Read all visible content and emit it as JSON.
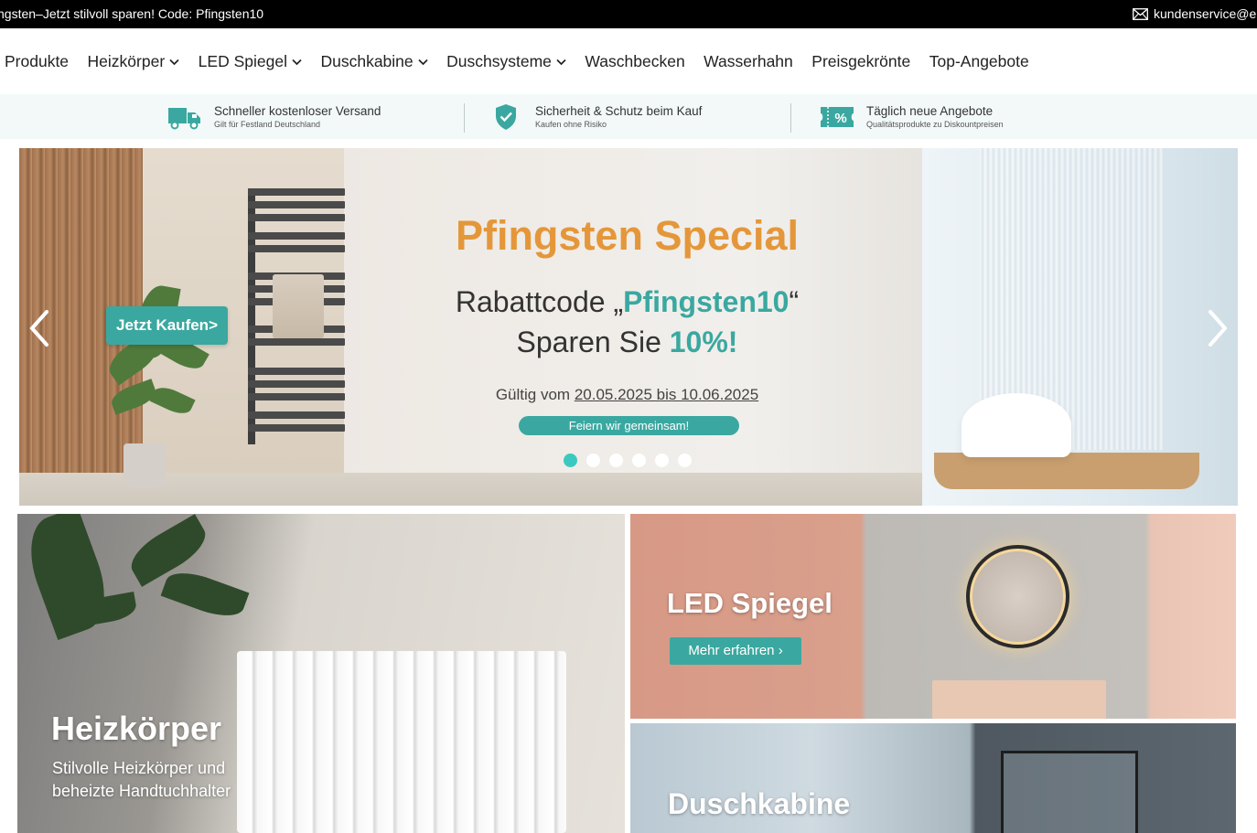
{
  "topbar": {
    "promo": "ngsten–Jetzt stilvoll sparen! Code: Pfingsten10",
    "email": "kundenservice@em",
    "mail_icon": "envelope-icon"
  },
  "nav": {
    "items": [
      {
        "label": "Produkte",
        "dropdown": false
      },
      {
        "label": "Heizkörper",
        "dropdown": true
      },
      {
        "label": "LED Spiegel",
        "dropdown": true
      },
      {
        "label": "Duschkabine",
        "dropdown": true
      },
      {
        "label": "Duschsysteme",
        "dropdown": true
      },
      {
        "label": "Waschbecken",
        "dropdown": false
      },
      {
        "label": "Wasserhahn",
        "dropdown": false
      },
      {
        "label": "Preisgekrönte",
        "dropdown": false
      },
      {
        "label": "Top-Angebote",
        "dropdown": false
      }
    ]
  },
  "benefits": [
    {
      "icon": "truck-icon",
      "title": "Schneller kostenloser Versand",
      "subtitle": "Gilt für Festland Deutschland"
    },
    {
      "icon": "shield-check-icon",
      "title": "Sicherheit & Schutz beim Kauf",
      "subtitle": "Kaufen ohne Risiko"
    },
    {
      "icon": "discount-ticket-icon",
      "title": "Täglich neue Angebote",
      "subtitle": "Qualitätsprodukte zu Diskountpreisen"
    }
  ],
  "hero": {
    "title": "Pfingsten Special",
    "code_prefix": "Rabattcode „",
    "code": "Pfingsten10",
    "code_suffix": "“",
    "save_prefix": "Sparen Sie ",
    "save_value": "10%!",
    "valid_prefix": "Gültig vom ",
    "valid_range": "20.05.2025 bis 10.06.2025",
    "pill": "Feiern wir gemeinsam!",
    "buy_button": "Jetzt Kaufen>",
    "slide_count": 6,
    "active_slide": 1
  },
  "tiles": {
    "heizkoerper": {
      "title": "Heizkörper",
      "subtitle": "Stilvolle Heizkörper und beheizte Handtuchhalter"
    },
    "led_spiegel": {
      "title": "LED Spiegel",
      "button": "Mehr erfahren ›"
    },
    "duschkabine": {
      "title": "Duschkabine"
    }
  },
  "colors": {
    "accent": "#3aa8a0",
    "hero_title": "#e4973a",
    "topbar": "#000000",
    "benefits_bg": "#f3f9f9"
  }
}
